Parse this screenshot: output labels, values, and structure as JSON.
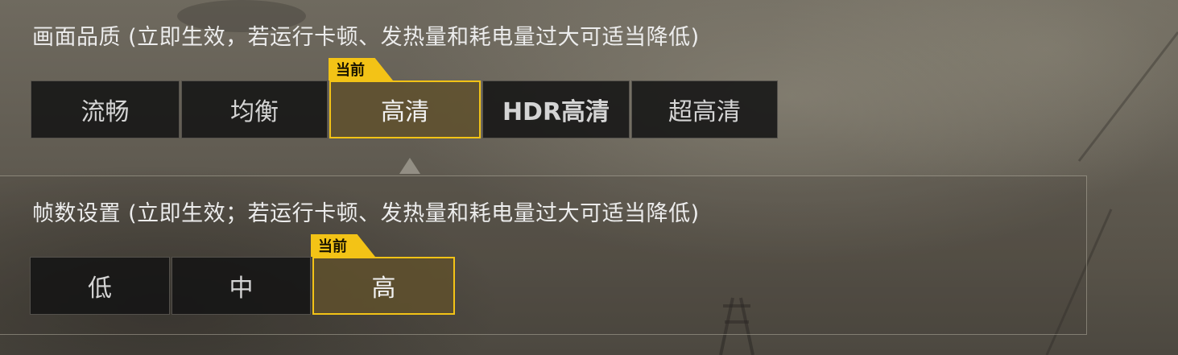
{
  "quality": {
    "title": "画面品质 (立即生效，若运行卡顿、发热量和耗电量过大可适当降低)",
    "current_tag": "当前",
    "options": [
      {
        "label": "流畅"
      },
      {
        "label": "均衡"
      },
      {
        "label": "高清"
      },
      {
        "label": "HDR高清"
      },
      {
        "label": "超高清"
      }
    ],
    "selected": "高清"
  },
  "fps": {
    "title": "帧数设置 (立即生效；若运行卡顿、发热量和耗电量过大可适当降低)",
    "current_tag": "当前",
    "options": [
      {
        "label": "低"
      },
      {
        "label": "中"
      },
      {
        "label": "高"
      }
    ],
    "selected": "高"
  },
  "colors": {
    "accent": "#f3c316",
    "option_bg": "#141414",
    "selected_bg": "#5f502d"
  }
}
